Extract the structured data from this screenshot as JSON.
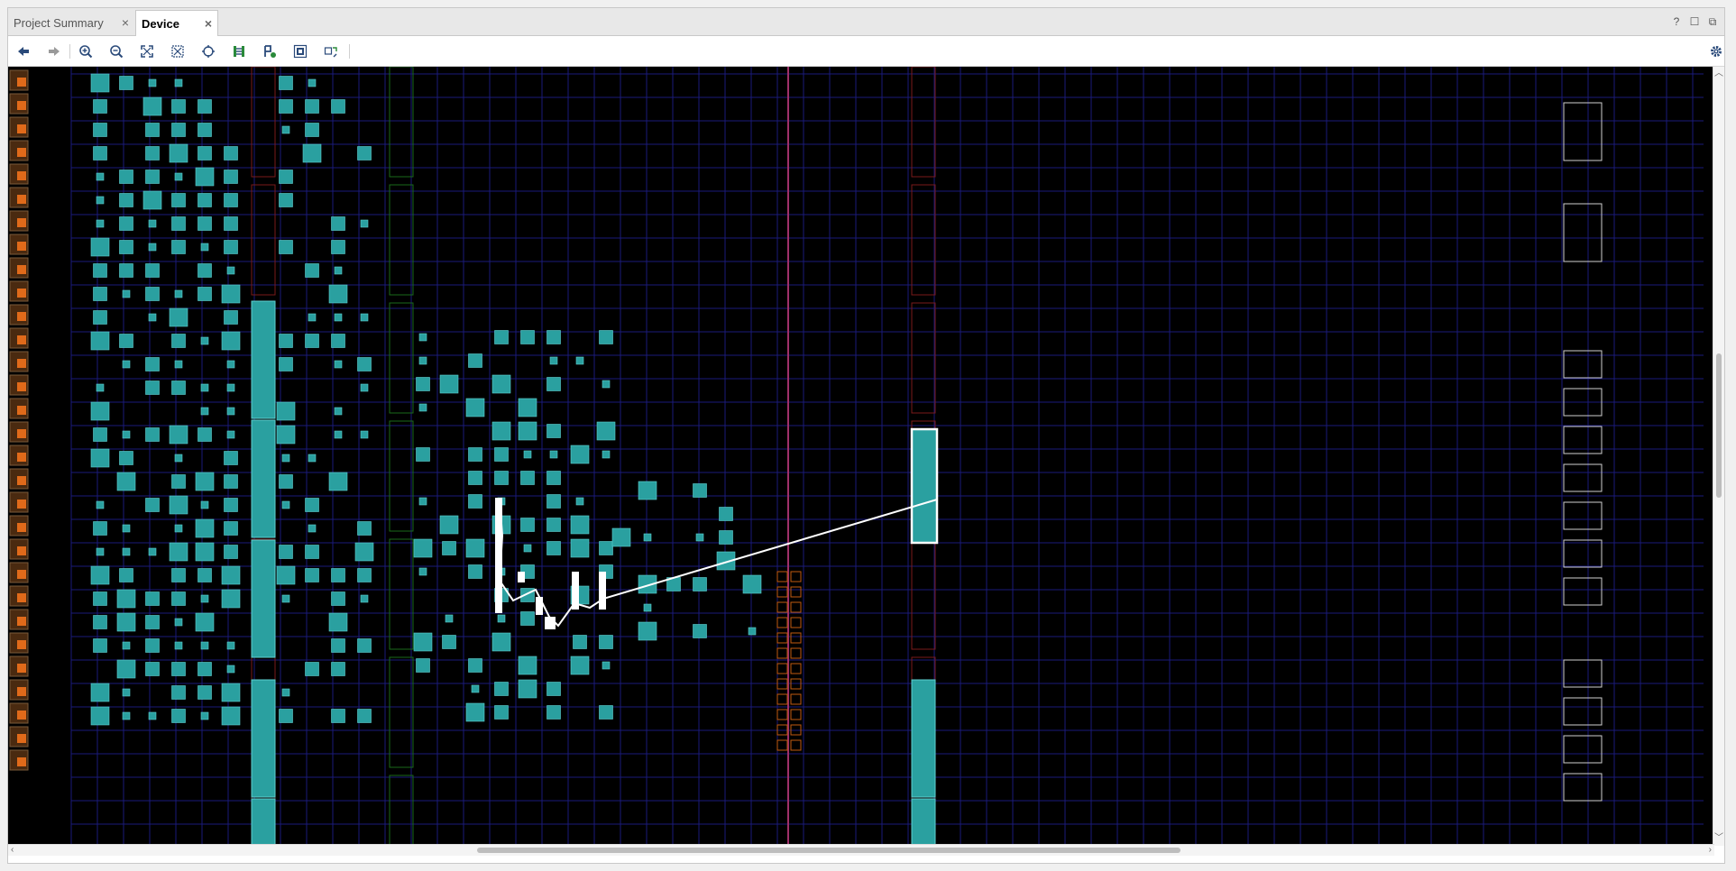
{
  "tabs": [
    {
      "label": "Project Summary",
      "active": false
    },
    {
      "label": "Device",
      "active": true
    }
  ],
  "tab_icons": [
    "help-icon",
    "maximize-icon",
    "float-icon"
  ],
  "toolbar": {
    "buttons": [
      "back-arrow-icon",
      "forward-arrow-icon",
      "zoom-in-icon",
      "zoom-out-icon",
      "zoom-fit-icon",
      "zoom-selection-icon",
      "crosshair-icon",
      "route-icon",
      "place-icon",
      "cell-view-icon",
      "rotate-icon"
    ],
    "settings": "gear-icon"
  },
  "colors": {
    "background": "#000000",
    "grid": "#1a1a7a",
    "cell": "#2aa0a0",
    "cell_border": "#5fd0d0",
    "io": "#e06a1a",
    "clock_line": "#a0306a",
    "selection": "#ffffff",
    "bram_outline": "#7a1a1a",
    "dsp_outline": "#1a6a1a",
    "ioblock": "#c05a10"
  }
}
